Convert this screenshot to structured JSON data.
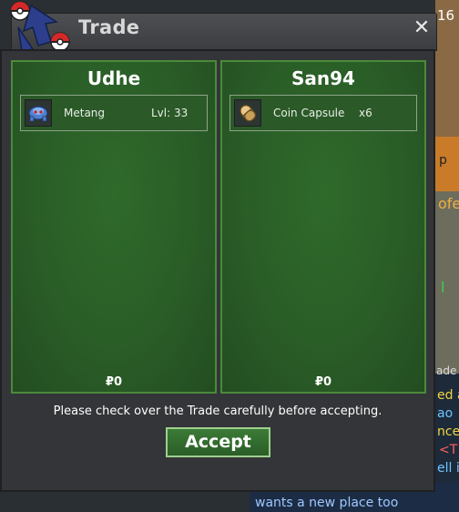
{
  "window": {
    "title": "Trade",
    "close_symbol": "✕"
  },
  "left_panel": {
    "player": "Udhe",
    "item": {
      "name": "Metang",
      "level": "Lvl: 33",
      "icon": "metang-icon"
    },
    "money": "₽0"
  },
  "right_panel": {
    "player": "San94",
    "item": {
      "name": "Coin Capsule",
      "quantity": "x6",
      "icon": "coin-capsule-icon"
    },
    "money": "₽0"
  },
  "notice": "Please check over the Trade carefully before accepting.",
  "accept_label": "Accept",
  "background": {
    "chat_line": "wants a new place too",
    "fragments": [
      "16",
      "p",
      "ofe",
      "l",
      "ade",
      "ed a",
      "ao",
      "nce",
      "<T",
      "ell i"
    ]
  },
  "colors": {
    "panel_green": "#2a5d27",
    "panel_border": "#4a8a3a",
    "titlebar": "#45474a",
    "accept_border": "#9fd08e"
  }
}
